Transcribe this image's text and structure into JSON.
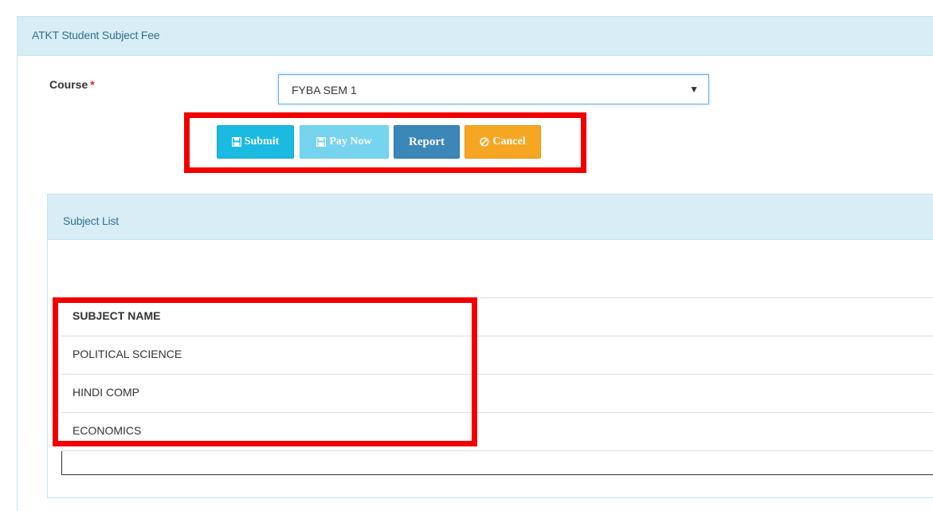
{
  "panel": {
    "title": "ATKT Student Subject Fee"
  },
  "form": {
    "course_label": "Course",
    "required_mark": "*",
    "course_value": "FYBA SEM 1"
  },
  "buttons": {
    "submit": "Submit",
    "pay_now": "Pay Now",
    "report": "Report",
    "cancel": "Cancel"
  },
  "subject_list": {
    "title": "Subject List",
    "header": "SUBJECT NAME",
    "rows": [
      "POLITICAL SCIENCE",
      "HINDI COMP",
      "ECONOMICS"
    ]
  },
  "colors": {
    "highlight": "#f20000",
    "panel_heading": "#d9edf7",
    "submit": "#1bbae1",
    "pay_now": "#76d4ee",
    "report": "#3a87b8",
    "cancel": "#f5a623"
  },
  "icons": {
    "submit": "save-icon",
    "pay_now": "save-icon",
    "cancel": "ban-icon",
    "select": "caret-down-icon"
  }
}
